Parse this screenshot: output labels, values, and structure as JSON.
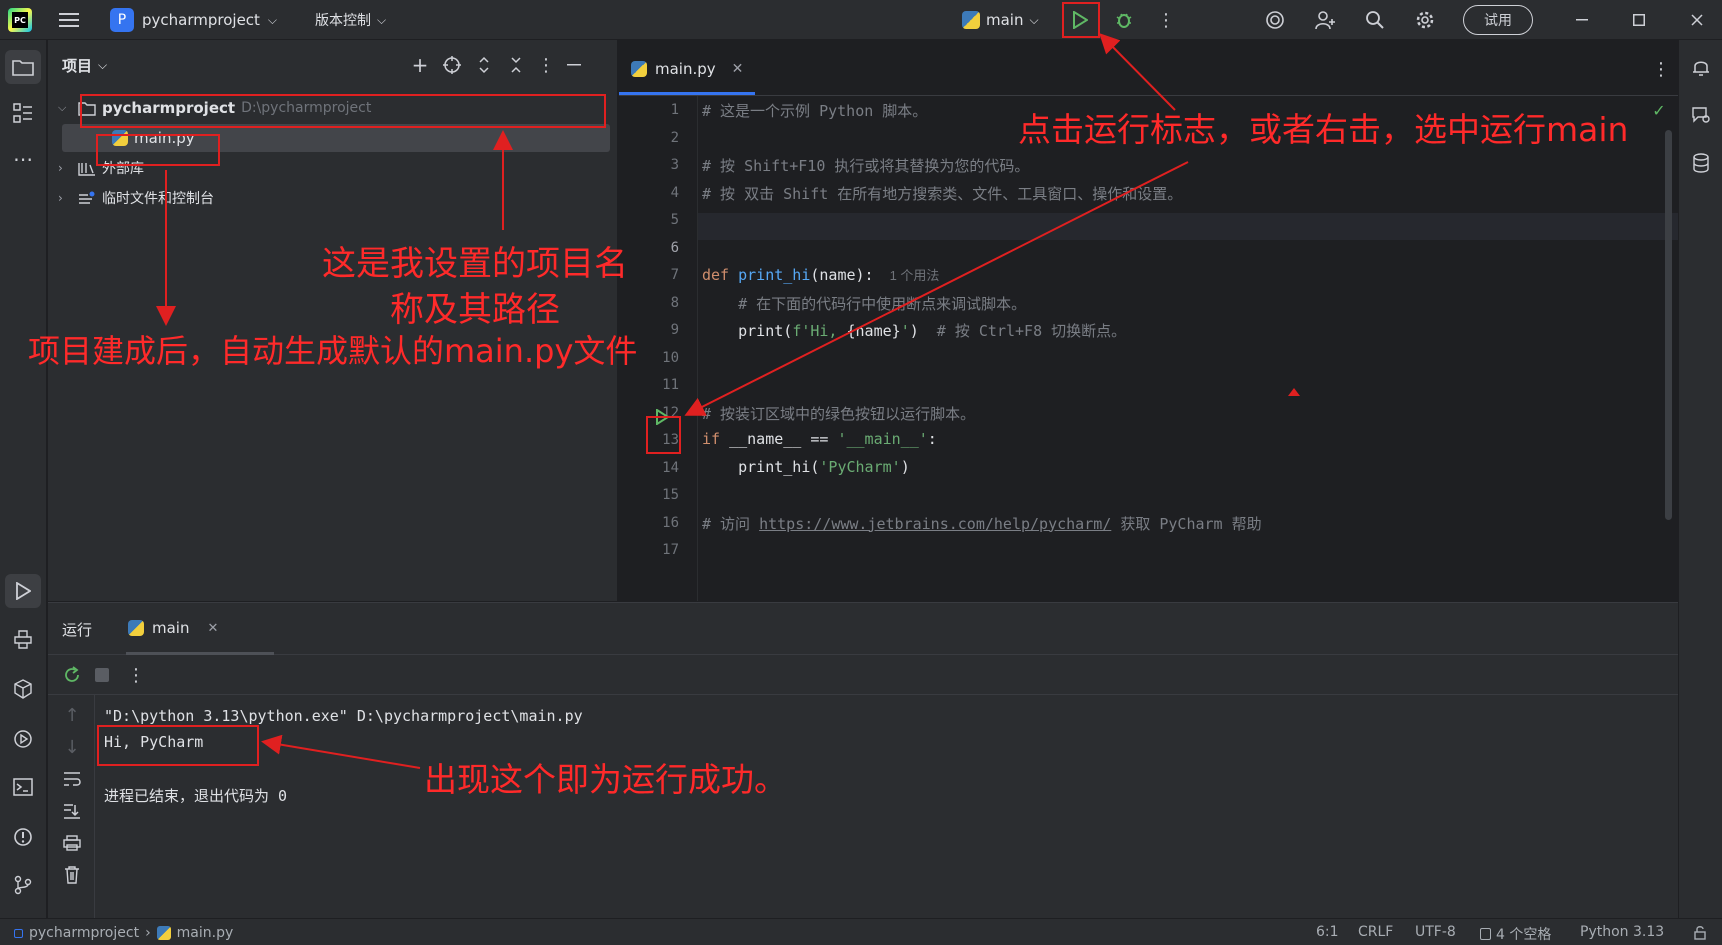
{
  "titlebar": {
    "app_logo": "PC",
    "project_badge": "P",
    "project_name": "pycharmproject",
    "vcs_label": "版本控制",
    "run_config": "main",
    "trial_button": "试用",
    "icons": [
      "hamburger-menu-icon",
      "run-icon",
      "debug-icon",
      "more-icon",
      "ai-assistant-icon",
      "add-user-icon",
      "search-icon",
      "settings-icon",
      "minimize-icon",
      "maximize-icon",
      "close-icon"
    ]
  },
  "project_panel": {
    "title": "项目",
    "tree": {
      "root_name": "pycharmproject",
      "root_path": "D:\\pycharmproject",
      "file": "main.py",
      "external_libs": "外部库",
      "scratches": "临时文件和控制台"
    }
  },
  "editor": {
    "tab": "main.py",
    "usage_hint": "1 个用法",
    "lines": [
      {
        "n": "1",
        "code": "# 这是一个示例 Python 脚本。"
      },
      {
        "n": "2",
        "code": ""
      },
      {
        "n": "3",
        "code": "# 按 Shift+F10 执行或将其替换为您的代码。"
      },
      {
        "n": "4",
        "code": "# 按 双击 Shift 在所有地方搜索类、文件、工具窗口、操作和设置。"
      },
      {
        "n": "5",
        "code": ""
      },
      {
        "n": "6",
        "code": ""
      },
      {
        "n": "7",
        "code": "def print_hi(name):"
      },
      {
        "n": "8",
        "code": "    # 在下面的代码行中使用断点来调试脚本。"
      },
      {
        "n": "9",
        "code": "    print(f'Hi, {name}')  # 按 Ctrl+F8 切换断点。"
      },
      {
        "n": "10",
        "code": ""
      },
      {
        "n": "11",
        "code": ""
      },
      {
        "n": "12",
        "code": "# 按装订区域中的绿色按钮以运行脚本。"
      },
      {
        "n": "13",
        "code": "if __name__ == '__main__':"
      },
      {
        "n": "14",
        "code": "    print_hi('PyCharm')"
      },
      {
        "n": "15",
        "code": ""
      },
      {
        "n": "16",
        "code": "# 访问 https://www.jetbrains.com/help/pycharm/ 获取 PyCharm 帮助"
      },
      {
        "n": "17",
        "code": ""
      }
    ],
    "line9_parts": {
      "indent": "    ",
      "print": "print(",
      "str1": "f'Hi, ",
      "brace": "{name}",
      "str2": "'",
      "close": ")",
      "comment": "  # 按 Ctrl+F8 切换断点。"
    },
    "line13_parts": {
      "kw": "if",
      "mid": " __name__ == ",
      "str": "'__main__'",
      "end": ":"
    },
    "line14_parts": {
      "indent": "    ",
      "fn": "print_hi(",
      "str": "'PyCharm'",
      "end": ")"
    },
    "line16_parts": {
      "pre": "# 访问 ",
      "link": "https://www.jetbrains.com/help/pycharm/",
      "post": " 获取 PyCharm 帮助"
    },
    "line7_parts": {
      "kw": "def",
      "fn": "print_hi",
      "rest": "(name):"
    }
  },
  "run_panel": {
    "title": "运行",
    "tab": "main",
    "output": [
      "\"D:\\python 3.13\\python.exe\" D:\\pycharmproject\\main.py",
      "Hi, PyCharm",
      "",
      "进程已结束，退出代码为 0"
    ]
  },
  "statusbar": {
    "breadcrumb_project": "pycharmproject",
    "breadcrumb_file": "main.py",
    "position": "6:1",
    "line_sep": "CRLF",
    "encoding": "UTF-8",
    "indent": "4 个空格",
    "interpreter": "Python 3.13"
  },
  "annotations": {
    "run_hint": "点击运行标志，或者右击，选中运行main",
    "project_name_hint_1": "这是我设置的项目名",
    "project_name_hint_2": "称及其路径",
    "default_file_hint": "项目建成后，自动生成默认的main.py文件",
    "success_hint": "出现这个即为运行成功。"
  },
  "colors": {
    "annotation_red": "#ff2a2a",
    "run_green": "#5fb865",
    "accent_blue": "#3574f0"
  }
}
